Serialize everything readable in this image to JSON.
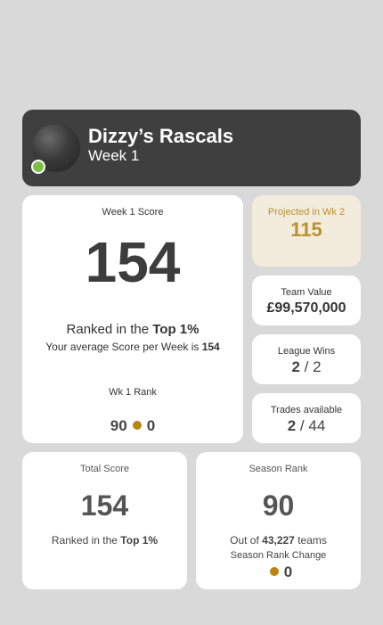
{
  "header": {
    "team_name": "Dizzy’s Rascals",
    "week": "Week 1",
    "status_color": "#7bc043"
  },
  "weekly": {
    "title": "Week 1 Score",
    "score": "154",
    "ranked_prefix": "Ranked in the ",
    "ranked_value": "Top 1%",
    "avg_prefix": "Your average Score per Week is ",
    "avg_value": "154",
    "rank_label": "Wk 1 Rank",
    "rank_value": "90",
    "rank_change": "0"
  },
  "projected": {
    "label": "Projected in Wk 2",
    "value": "115",
    "accent": "#b8922e"
  },
  "team_value": {
    "label": "Team Value",
    "value": "£99,570,000"
  },
  "league_wins": {
    "label": "League Wins",
    "value": "2",
    "total": "2"
  },
  "trades": {
    "label": "Trades available",
    "value": "2",
    "total": "44"
  },
  "total": {
    "title": "Total Score",
    "score": "154",
    "ranked_prefix": "Ranked in the ",
    "ranked_value": "Top 1%"
  },
  "season": {
    "title": "Season Rank",
    "rank": "90",
    "out_of_prefix": "Out of ",
    "out_of_value": "43,227",
    "out_of_suffix": " teams",
    "change_label": "Season Rank Change",
    "change_value": "0"
  }
}
